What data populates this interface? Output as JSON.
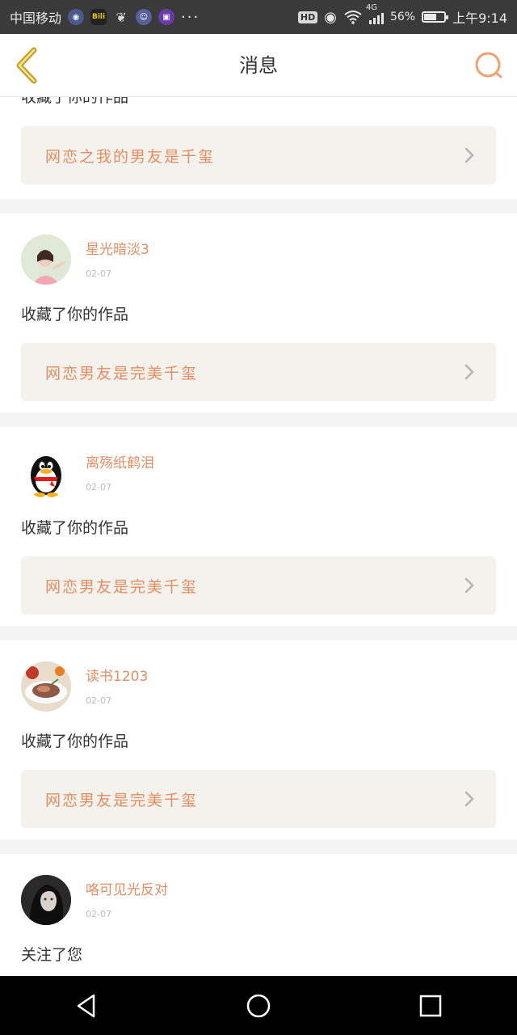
{
  "status_bar": {
    "carrier": "中国移动",
    "network": "4G",
    "battery": "56%",
    "battery_level": 0.56,
    "time": "上午9:14",
    "hd_badge": "HD",
    "more_dots": "···",
    "bili_label": "Bili"
  },
  "header": {
    "title": "消息",
    "back_icon": "chevron-left-icon",
    "search_icon": "search-icon"
  },
  "partial_top": {
    "action": "收藏了你的作品",
    "work_title": "网恋之我的男友是千玺"
  },
  "messages": [
    {
      "username": "星光暗淡3",
      "date": "02-07",
      "action": "收藏了你的作品",
      "work_title": "网恋男友是完美千玺",
      "avatar_icon": "user-photo-avatar"
    },
    {
      "username": "离殇纸鹤泪",
      "date": "02-07",
      "action": "收藏了你的作品",
      "work_title": "网恋男友是完美千玺",
      "avatar_icon": "penguin-avatar"
    },
    {
      "username": "读书1203",
      "date": "02-07",
      "action": "收藏了你的作品",
      "work_title": "网恋男友是完美千玺",
      "avatar_icon": "food-photo-avatar"
    },
    {
      "username": "咯可见光反对",
      "date": "02-07",
      "action": "关注了您",
      "avatar_icon": "portrait-photo-avatar"
    }
  ],
  "colors": {
    "accent": "#e58d62",
    "work_box_bg": "#f3f2ec",
    "back_icon": "#c9a020",
    "search_icon": "#f0a26e"
  },
  "navbar": {
    "back_icon": "triangle-back-icon",
    "home_icon": "circle-home-icon",
    "recents_icon": "square-recents-icon"
  }
}
